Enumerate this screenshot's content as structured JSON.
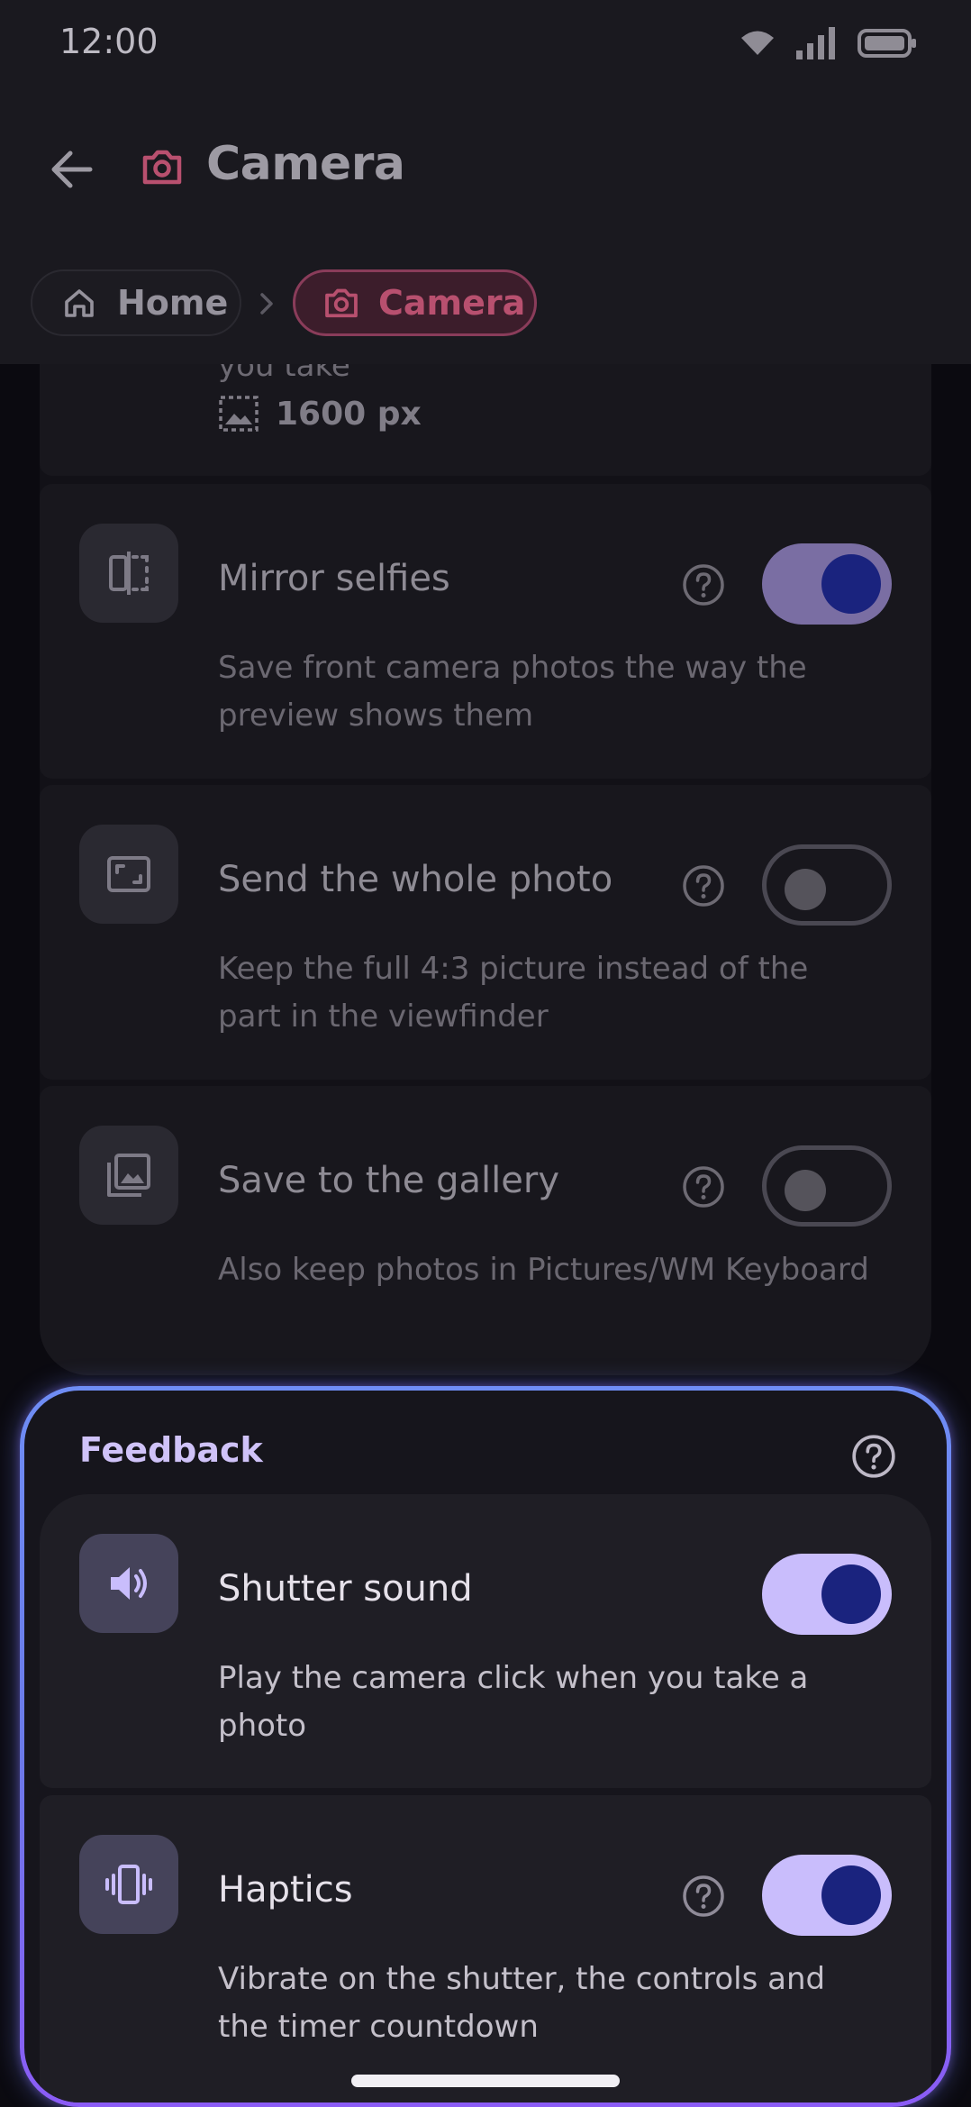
{
  "status_bar": {
    "time": "12:00"
  },
  "app_bar": {
    "title": "Camera",
    "back_icon": "arrow-left-icon",
    "title_icon": "camera-icon"
  },
  "breadcrumb": {
    "home_label": "Home",
    "camera_label": "Camera"
  },
  "partial_card": {
    "text": "you take",
    "size_value": "1600 px"
  },
  "settings": [
    {
      "title": "Mirror selfies",
      "description": "Save front camera photos the way the preview shows them",
      "icon": "mirror-icon",
      "enabled": true
    },
    {
      "title": "Send the whole photo",
      "description": "Keep the full 4:3 picture instead of the part in the viewfinder",
      "icon": "crop-full-icon",
      "enabled": false
    },
    {
      "title": "Save to the gallery",
      "description": "Also keep photos in Pictures/WM Keyboard",
      "icon": "gallery-icon",
      "enabled": false
    }
  ],
  "feedback": {
    "title": "Feedback",
    "items": [
      {
        "title": "Shutter sound",
        "description": "Play the camera click when you take a photo",
        "icon": "speaker-icon",
        "enabled": true
      },
      {
        "title": "Haptics",
        "description": "Vibrate on the shutter, the controls and the timer countdown",
        "icon": "vibration-icon",
        "enabled": true
      }
    ]
  },
  "colors": {
    "accent": "#c9bdfc",
    "toggle_knob": "#1a237e",
    "breadcrumb_active": "#b8506f",
    "section_border_start": "#6f8df5",
    "section_border_end": "#8b5cf6"
  }
}
